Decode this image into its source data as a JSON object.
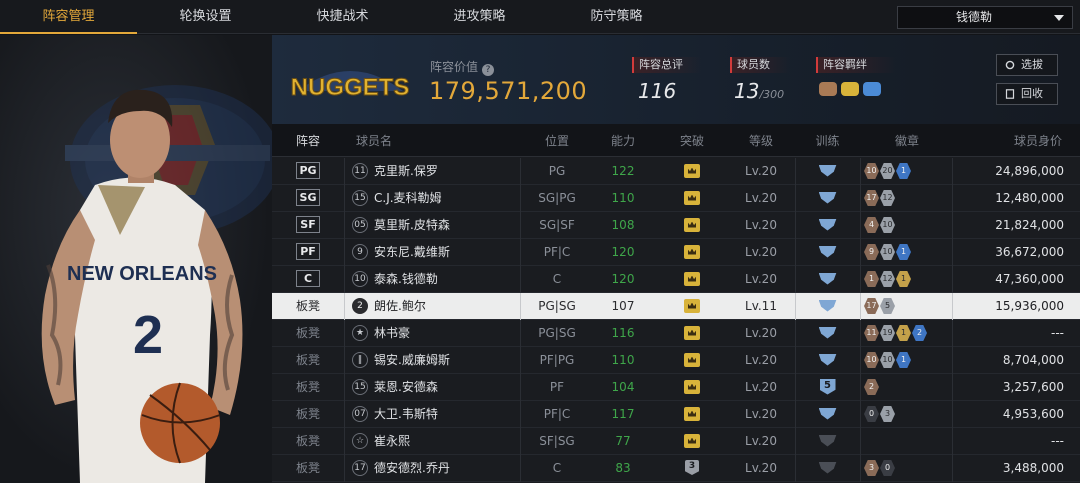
{
  "nav": {
    "tabs": [
      "阵容管理",
      "轮换设置",
      "快捷战术",
      "进攻策略",
      "防守策略"
    ],
    "active_tab": 0,
    "team_select": "钱德勒"
  },
  "player_art": {
    "jersey_city": "NEW ORLEANS",
    "jersey_number": "2"
  },
  "header": {
    "team_logo_text": "NUGGETS",
    "value_label": "阵容价值",
    "value": "179,571,200",
    "rating_label": "阵容总评",
    "rating": "116",
    "players_label": "球员数",
    "players": "13",
    "players_max": "/300",
    "bond_label": "阵容羁绊",
    "btn_select": "选拔",
    "btn_recycle": "回收"
  },
  "table": {
    "columns": [
      "阵容",
      "球员名",
      "位置",
      "能力",
      "突破",
      "等级",
      "训练",
      "徽章",
      "球员身价"
    ],
    "rows": [
      {
        "slot": "PG",
        "starter": true,
        "no": "11",
        "name": "克里斯.保罗",
        "pos": "PG",
        "ability": "122",
        "breakthrough": "crown",
        "level": "Lv.20",
        "train": "blue",
        "badges": [
          [
            "bronze",
            "10"
          ],
          [
            "silver",
            "20"
          ],
          [
            "blue",
            "1"
          ]
        ],
        "salary": "24,896,000"
      },
      {
        "slot": "SG",
        "starter": true,
        "no": "15",
        "name": "C.J.麦科勒姆",
        "pos": "SG|PG",
        "ability": "110",
        "breakthrough": "crown",
        "level": "Lv.20",
        "train": "blue",
        "badges": [
          [
            "bronze",
            "17"
          ],
          [
            "silver",
            "12"
          ]
        ],
        "salary": "12,480,000"
      },
      {
        "slot": "SF",
        "starter": true,
        "no": "05",
        "name": "莫里斯.皮特森",
        "pos": "SG|SF",
        "ability": "108",
        "breakthrough": "crown",
        "level": "Lv.20",
        "train": "blue",
        "badges": [
          [
            "bronze",
            "4"
          ],
          [
            "silver",
            "10"
          ]
        ],
        "salary": "21,824,000"
      },
      {
        "slot": "PF",
        "starter": true,
        "no": "9",
        "name": "安东尼.戴维斯",
        "pos": "PF|C",
        "ability": "120",
        "breakthrough": "crown",
        "level": "Lv.20",
        "train": "blue",
        "badges": [
          [
            "bronze",
            "9"
          ],
          [
            "silver",
            "10"
          ],
          [
            "blue",
            "1"
          ]
        ],
        "salary": "36,672,000"
      },
      {
        "slot": "C",
        "starter": true,
        "no": "10",
        "name": "泰森.钱德勒",
        "pos": "C",
        "ability": "120",
        "breakthrough": "crown",
        "level": "Lv.20",
        "train": "blue",
        "badges": [
          [
            "bronze",
            "1"
          ],
          [
            "silver",
            "12"
          ],
          [
            "gold",
            "1"
          ]
        ],
        "salary": "47,360,000"
      },
      {
        "slot": "板凳",
        "starter": false,
        "selected": true,
        "no": "2",
        "name": "朗佐.鲍尔",
        "pos": "PG|SG",
        "ability": "107",
        "breakthrough": "crown",
        "level": "Lv.11",
        "train": "blue",
        "badges": [
          [
            "bronze",
            "17"
          ],
          [
            "silver",
            "5"
          ]
        ],
        "salary": "15,936,000"
      },
      {
        "slot": "板凳",
        "starter": false,
        "no": "★",
        "name": "林书豪",
        "pos": "PG|SG",
        "ability": "116",
        "breakthrough": "crown",
        "level": "Lv.20",
        "train": "blue",
        "badges": [
          [
            "bronze",
            "11"
          ],
          [
            "silver",
            "19"
          ],
          [
            "gold",
            "1"
          ],
          [
            "blue",
            "2"
          ]
        ],
        "salary": "---"
      },
      {
        "slot": "板凳",
        "starter": false,
        "no": "‖",
        "name": "锡安.威廉姆斯",
        "pos": "PF|PG",
        "ability": "110",
        "breakthrough": "crown",
        "level": "Lv.20",
        "train": "blue",
        "badges": [
          [
            "bronze",
            "10"
          ],
          [
            "silver",
            "10"
          ],
          [
            "blue",
            "1"
          ]
        ],
        "salary": "8,704,000"
      },
      {
        "slot": "板凳",
        "starter": false,
        "no": "15",
        "name": "莱恩.安德森",
        "pos": "PF",
        "ability": "104",
        "breakthrough": "crown",
        "level": "Lv.20",
        "train": "num5",
        "badges": [
          [
            "bronze",
            "2"
          ]
        ],
        "salary": "3,257,600"
      },
      {
        "slot": "板凳",
        "starter": false,
        "no": "07",
        "name": "大卫.韦斯特",
        "pos": "PF|C",
        "ability": "117",
        "breakthrough": "crown",
        "level": "Lv.20",
        "train": "blue",
        "badges": [
          [
            "dark",
            "0"
          ],
          [
            "silver",
            "3"
          ]
        ],
        "salary": "4,953,600"
      },
      {
        "slot": "板凳",
        "starter": false,
        "no": "☆",
        "name": "崔永熙",
        "pos": "SF|SG",
        "ability": "77",
        "breakthrough": "crown",
        "level": "Lv.20",
        "train": "grey",
        "badges": [],
        "salary": "---"
      },
      {
        "slot": "板凳",
        "starter": false,
        "no": "17",
        "name": "德安德烈.乔丹",
        "pos": "C",
        "ability": "83",
        "breakthrough": "grey3",
        "level": "Lv.20",
        "train": "grey",
        "badges": [
          [
            "bronze",
            "3"
          ],
          [
            "dark",
            "0"
          ]
        ],
        "salary": "3,488,000"
      }
    ]
  }
}
